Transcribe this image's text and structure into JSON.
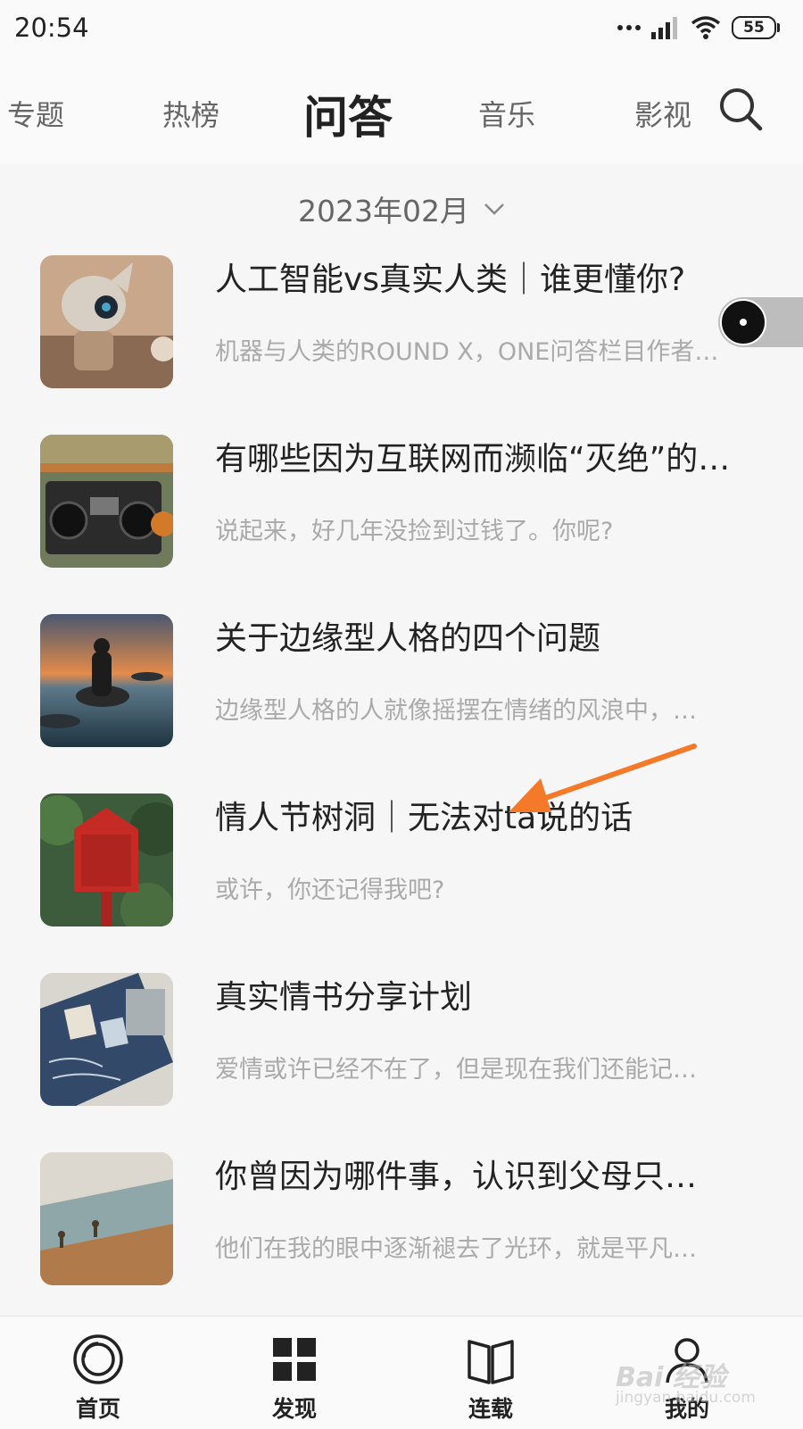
{
  "status_bar": {
    "time": "20:54",
    "battery": "55"
  },
  "top_nav": {
    "tabs": [
      {
        "label": "专题"
      },
      {
        "label": "热榜"
      },
      {
        "label": "问答",
        "active": true
      },
      {
        "label": "音乐"
      },
      {
        "label": "影视"
      }
    ],
    "search_icon": "search-icon"
  },
  "month_selector": {
    "label": "2023年02月",
    "icon": "chevron-down-icon"
  },
  "articles": [
    {
      "title": "人工智能vs真实人类｜谁更懂你?",
      "desc": "机器与人类的ROUND X，ONE问答栏目作者…"
    },
    {
      "title": "有哪些因为互联网而濒临“灭绝”的…",
      "desc": "说起来，好几年没捡到过钱了。你呢?"
    },
    {
      "title": "关于边缘型人格的四个问题",
      "desc": "边缘型人格的人就像摇摆在情绪的风浪中，…"
    },
    {
      "title": "情人节树洞｜无法对ta说的话",
      "desc": "或许，你还记得我吧?"
    },
    {
      "title": "真实情书分享计划",
      "desc": "爱情或许已经不在了，但是现在我们还能记…"
    },
    {
      "title": "你曾因为哪件事，认识到父母只…",
      "desc": "他们在我的眼中逐渐褪去了光环，就是平凡…"
    }
  ],
  "bottom_nav": {
    "items": [
      {
        "label": "首页",
        "icon": "home-circle-icon"
      },
      {
        "label": "发现",
        "icon": "grid-icon"
      },
      {
        "label": "连载",
        "icon": "book-icon"
      },
      {
        "label": "我的",
        "icon": "person-icon"
      }
    ]
  },
  "watermark": {
    "text": "Bai 经验",
    "sub": "jingyan.baidu.com"
  },
  "colors": {
    "annotation_arrow": "#f47a2a",
    "text_primary": "#222222",
    "text_secondary": "#aaaaaa"
  }
}
